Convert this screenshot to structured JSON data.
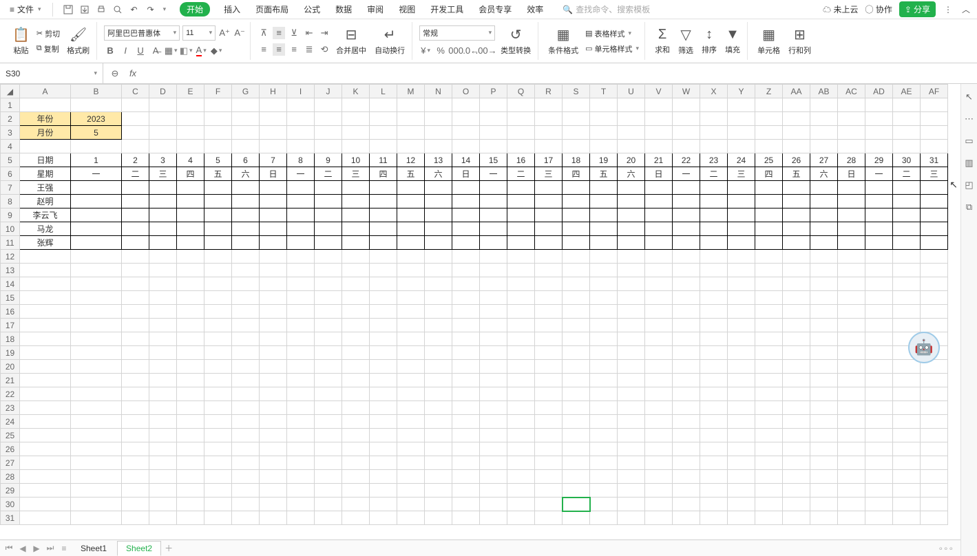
{
  "menubar": {
    "file": "文件",
    "tabs": [
      "开始",
      "插入",
      "页面布局",
      "公式",
      "数据",
      "审阅",
      "视图",
      "开发工具",
      "会员专享",
      "效率"
    ],
    "active_tab": 0,
    "search_placeholder": "查找命令、搜索模板",
    "cloud": "未上云",
    "collab": "协作",
    "share": "分享"
  },
  "ribbon": {
    "paste": "粘贴",
    "cut": "剪切",
    "copy": "复制",
    "format_painter": "格式刷",
    "font_name": "阿里巴巴普惠体",
    "font_size": "11",
    "merge_center": "合并居中",
    "auto_wrap": "自动换行",
    "number_format": "常规",
    "type_convert": "类型转换",
    "cond_format": "条件格式",
    "table_style": "表格样式",
    "cell_style": "单元格样式",
    "sum": "求和",
    "filter": "筛选",
    "sort": "排序",
    "fill": "填充",
    "cell": "单元格",
    "rowcol": "行和列"
  },
  "namebox": {
    "ref": "S30"
  },
  "columns": [
    "A",
    "B",
    "C",
    "D",
    "E",
    "F",
    "G",
    "H",
    "I",
    "J",
    "K",
    "L",
    "M",
    "N",
    "O",
    "P",
    "Q",
    "R",
    "S",
    "T",
    "U",
    "V",
    "W",
    "X",
    "Y",
    "Z",
    "AA",
    "AB",
    "AC",
    "AD",
    "AE",
    "AF"
  ],
  "data": {
    "A2": "年份",
    "B2": "2023",
    "A3": "月份",
    "B3": "5",
    "A5": "日期",
    "A6": "星期",
    "A7": "王强",
    "A8": "赵明",
    "A9": "李云飞",
    "A10": "马龙",
    "A11": "张辉",
    "row5": [
      "1",
      "2",
      "3",
      "4",
      "5",
      "6",
      "7",
      "8",
      "9",
      "10",
      "11",
      "12",
      "13",
      "14",
      "15",
      "16",
      "17",
      "18",
      "19",
      "20",
      "21",
      "22",
      "23",
      "24",
      "25",
      "26",
      "27",
      "28",
      "29",
      "30",
      "31"
    ],
    "row6": [
      "一",
      "二",
      "三",
      "四",
      "五",
      "六",
      "日",
      "一",
      "二",
      "三",
      "四",
      "五",
      "六",
      "日",
      "一",
      "二",
      "三",
      "四",
      "五",
      "六",
      "日",
      "一",
      "二",
      "三",
      "四",
      "五",
      "六",
      "日",
      "一",
      "二",
      "三"
    ]
  },
  "sheets": {
    "tabs": [
      "Sheet1",
      "Sheet2"
    ],
    "active": 1
  },
  "active_cell": {
    "col": "S",
    "row": 30
  }
}
